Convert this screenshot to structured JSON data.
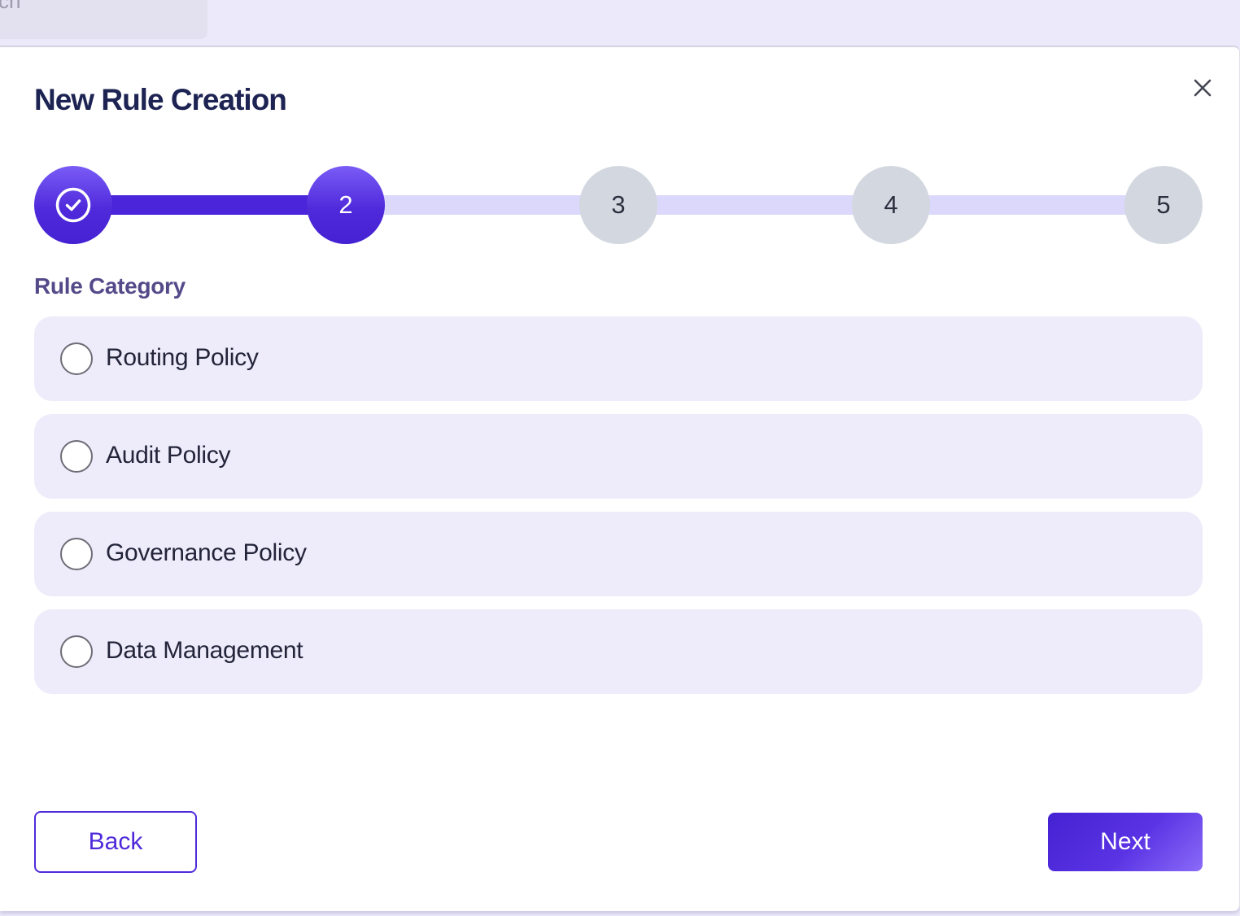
{
  "background": {
    "search_partial_text": "ch"
  },
  "modal": {
    "title": "New Rule Creation",
    "close_icon": "close-icon"
  },
  "stepper": {
    "current_step": 2,
    "total_steps": 5,
    "steps": [
      {
        "label": "",
        "state": "completed",
        "icon": "check-circle-icon"
      },
      {
        "label": "2",
        "state": "active"
      },
      {
        "label": "3",
        "state": "upcoming"
      },
      {
        "label": "4",
        "state": "upcoming"
      },
      {
        "label": "5",
        "state": "upcoming"
      }
    ]
  },
  "rule_category": {
    "label": "Rule Category",
    "selected": null,
    "options": [
      {
        "label": "Routing Policy",
        "checked": false
      },
      {
        "label": "Audit Policy",
        "checked": false
      },
      {
        "label": "Governance Policy",
        "checked": false
      },
      {
        "label": "Data Management",
        "checked": false
      }
    ]
  },
  "footer": {
    "back_label": "Back",
    "next_label": "Next"
  },
  "colors": {
    "primary": "#4f2adb",
    "track_inactive": "#dcd8fb",
    "step_inactive": "#d3d7df",
    "option_bg": "#eeecfa",
    "title": "#1d2352",
    "section_label": "#544a8a",
    "page_bg": "#eceafa"
  }
}
